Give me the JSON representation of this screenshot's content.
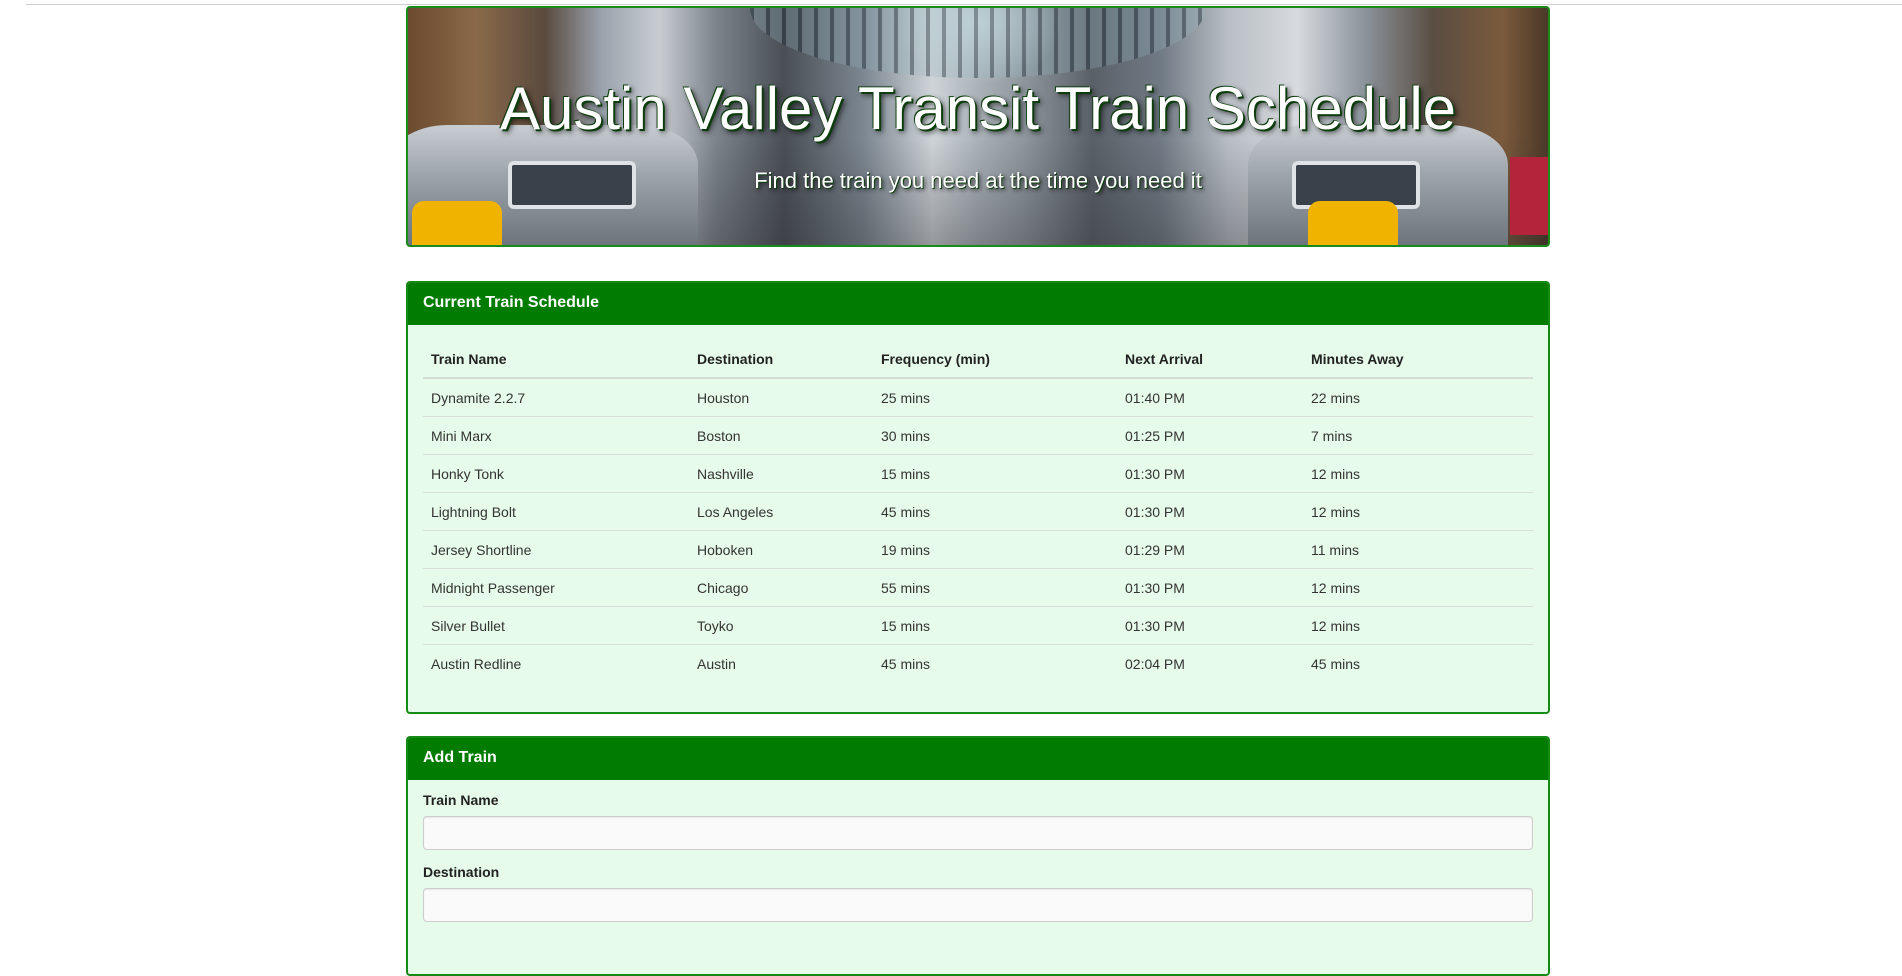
{
  "header": {
    "title": "Austin Valley Transit Train Schedule",
    "subtitle": "Find the train you need at the time you need it"
  },
  "schedule": {
    "heading": "Current Train Schedule",
    "columns": [
      "Train Name",
      "Destination",
      "Frequency (min)",
      "Next Arrival",
      "Minutes Away"
    ],
    "rows": [
      [
        "Dynamite 2.2.7",
        "Houston",
        "25 mins",
        "01:40 PM",
        "22 mins"
      ],
      [
        "Mini Marx",
        "Boston",
        "30 mins",
        "01:25 PM",
        "7 mins"
      ],
      [
        "Honky Tonk",
        "Nashville",
        "15 mins",
        "01:30 PM",
        "12 mins"
      ],
      [
        "Lightning Bolt",
        "Los Angeles",
        "45 mins",
        "01:30 PM",
        "12 mins"
      ],
      [
        "Jersey Shortline",
        "Hoboken",
        "19 mins",
        "01:29 PM",
        "11 mins"
      ],
      [
        "Midnight Passenger",
        "Chicago",
        "55 mins",
        "01:30 PM",
        "12 mins"
      ],
      [
        "Silver Bullet",
        "Toyko",
        "15 mins",
        "01:30 PM",
        "12 mins"
      ],
      [
        "Austin Redline",
        "Austin",
        "45 mins",
        "02:04 PM",
        "45 mins"
      ]
    ]
  },
  "add_train": {
    "heading": "Add Train",
    "fields": [
      {
        "label": "Train Name",
        "value": ""
      },
      {
        "label": "Destination",
        "value": ""
      }
    ]
  },
  "colors": {
    "panel_heading": "#017c01",
    "panel_border": "#168a16",
    "panel_body": "#e6fbe9"
  }
}
